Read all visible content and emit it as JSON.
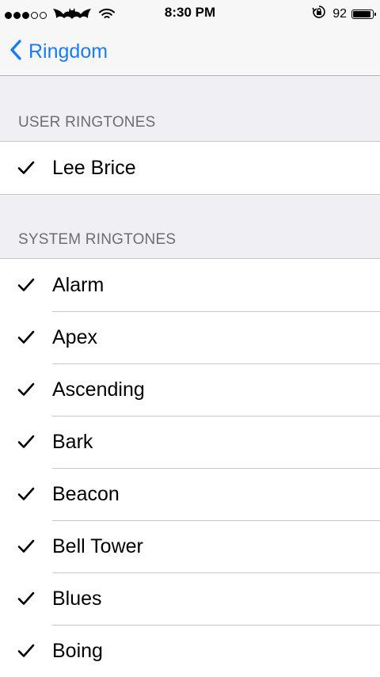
{
  "status_bar": {
    "time": "8:30 PM",
    "battery_percent": "92",
    "battery_level": 0.92,
    "signal_dots_filled": 3,
    "signal_dots_total": 5,
    "carrier_icon": "bat-logo-icon",
    "wifi_icon": "wifi-icon",
    "rotation_lock_icon": "rotation-lock-icon"
  },
  "nav": {
    "back_label": "Ringdom",
    "back_icon": "chevron-left-icon",
    "accent_color": "#1a7cf5"
  },
  "sections": {
    "user": {
      "header": "USER RINGTONES",
      "items": [
        "Lee Brice"
      ]
    },
    "system": {
      "header": "SYSTEM RINGTONES",
      "items": [
        "Alarm",
        "Apex",
        "Ascending",
        "Bark",
        "Beacon",
        "Bell Tower",
        "Blues",
        "Boing"
      ]
    }
  },
  "check_icon": "checkmark-icon"
}
